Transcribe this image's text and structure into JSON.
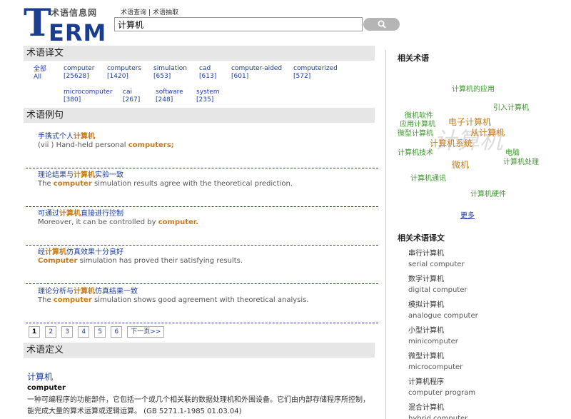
{
  "header": {
    "logo_big": "T",
    "logo_rest": "ERM",
    "logo_cn": "术语信息网",
    "tabs": [
      "术语查询",
      "术语抽取"
    ],
    "search_value": "计算机"
  },
  "translations": {
    "heading": "术语译文",
    "row1": [
      {
        "label": "全部",
        "count": "All"
      },
      {
        "label": "computer",
        "count": "[25628]"
      },
      {
        "label": "computers",
        "count": "[1420]"
      },
      {
        "label": "simulation",
        "count": "[653]"
      },
      {
        "label": "cad",
        "count": "[613]"
      },
      {
        "label": "computer-aided",
        "count": "[601]"
      },
      {
        "label": "computerized",
        "count": "[572]"
      }
    ],
    "row2": [
      {
        "label": "microcomputer",
        "count": "[380]"
      },
      {
        "label": "cai",
        "count": "[267]"
      },
      {
        "label": "software",
        "count": "[248]"
      },
      {
        "label": "system",
        "count": "[235]"
      }
    ]
  },
  "examples": {
    "heading": "术语例句",
    "items": [
      {
        "cn_pre": "手携式个人",
        "cn_hl": "计算机",
        "cn_post": "",
        "en_pre": "(vii ) Hand-held personal ",
        "en_hl": "computers;",
        "en_post": ""
      },
      {
        "cn_pre": "理论结果与",
        "cn_hl": "计算机",
        "cn_post": "实验一致",
        "en_pre": "The ",
        "en_hl": "computer",
        "en_post": " simulation results agree with the theoretical prediction."
      },
      {
        "cn_pre": "可通过",
        "cn_hl": "计算机",
        "cn_post": "直接进行控制",
        "en_pre": "Moreover, it can be controlled by ",
        "en_hl": "computer.",
        "en_post": ""
      },
      {
        "cn_pre": "经",
        "cn_hl": "计算机",
        "cn_post": "仿真效果十分良好",
        "en_pre": "",
        "en_hl": "Computer",
        "en_post": " simulation has proved their satisfying results."
      },
      {
        "cn_pre": "理论分析与",
        "cn_hl": "计算机",
        "cn_post": "仿真结果一致",
        "en_pre": "The ",
        "en_hl": "computer",
        "en_post": " simulation shows good agreement with theoretical analysis."
      }
    ]
  },
  "pager": {
    "pages": [
      "1",
      "2",
      "3",
      "4",
      "5",
      "6"
    ],
    "next": "下一页>>"
  },
  "definition": {
    "heading": "术语定义",
    "term": "计算机",
    "en": "computer",
    "text": "一种可编程序的功能部件，它包括一个或几个相关联的数据处理机和外围设备。它们由内部存储程序所控制，能完成大量的算术运算或逻辑运算。 (GB 5271.1-1985 01.03.04)"
  },
  "related": {
    "heading": "相关术语",
    "watermark": "计算机",
    "cloud": [
      {
        "text": "计算机的应用",
        "color": "#3a9a2a"
      },
      {
        "text": "引入计算机",
        "color": "#3a9a2a"
      },
      {
        "text": "微机软件",
        "color": "#3a9a2a"
      },
      {
        "text": "应用计算机",
        "color": "#3a9a2a"
      },
      {
        "text": "电子计算机",
        "color": "#c87a17"
      },
      {
        "text": "微型计算机",
        "color": "#3a9a2a"
      },
      {
        "text": "从计算机",
        "color": "#c87a17"
      },
      {
        "text": "计算机系统",
        "color": "#c87a17"
      },
      {
        "text": "计算机技术",
        "color": "#3a9a2a"
      },
      {
        "text": "电脑",
        "color": "#3a9a2a"
      },
      {
        "text": "计算机处理",
        "color": "#3a9a2a"
      },
      {
        "text": "微机",
        "color": "#c87a17"
      },
      {
        "text": "计算机通讯",
        "color": "#3a9a2a"
      },
      {
        "text": "计算机硬件",
        "color": "#3a9a2a"
      }
    ],
    "more": "更多"
  },
  "related_translations": {
    "heading": "相关术语译文",
    "items": [
      {
        "cn": "串行计算机",
        "en": "serial computer"
      },
      {
        "cn": "数字计算机",
        "en": "digital computer"
      },
      {
        "cn": "模拟计算机",
        "en": "analogue computer"
      },
      {
        "cn": "小型计算机",
        "en": "minicomputer"
      },
      {
        "cn": "微型计算机",
        "en": "microcomputer"
      },
      {
        "cn": "计算机程序",
        "en": "computer program"
      },
      {
        "cn": "混合计算机",
        "en": "hybrid computer"
      }
    ]
  }
}
